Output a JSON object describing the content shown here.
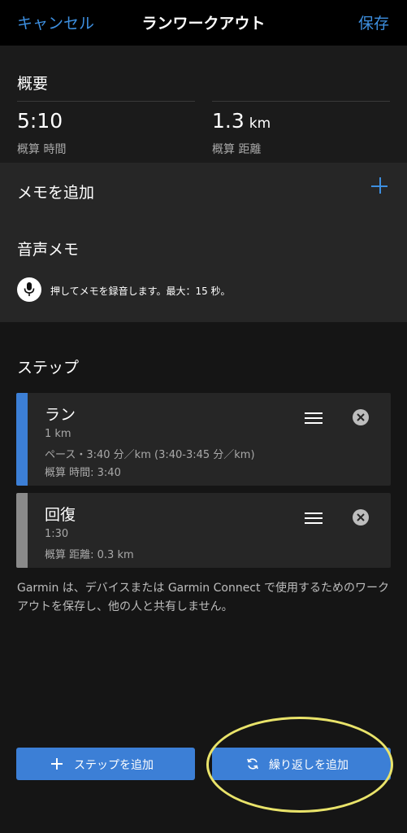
{
  "header": {
    "cancel_label": "キャンセル",
    "title": "ランワークアウト",
    "save_label": "保存"
  },
  "overview": {
    "section_title": "概要",
    "time_value": "5:10",
    "time_label": "概算 時間",
    "distance_value": "1.3",
    "distance_unit": "km",
    "distance_label": "概算 距離"
  },
  "notes": {
    "add_note_label": "メモを追加",
    "voice_memo_title": "音声メモ",
    "voice_memo_hint": "押してメモを録音します。最大：15 秒。"
  },
  "steps": {
    "section_title": "ステップ",
    "items": [
      {
        "name": "ラン",
        "line1": "1 km",
        "line2": "ペース・3:40 分／km (3:40-3:45 分／km)",
        "line3": "概算 時間: 3:40",
        "color": "#3c7fd6"
      },
      {
        "name": "回復",
        "line1": "1:30",
        "line2": "概算 距離: 0.3 km",
        "color": "#8a8a8a"
      }
    ]
  },
  "disclaimer": "Garmin は、デバイスまたは Garmin Connect で使用するためのワークアウトを保存し、他の人と共有しません。",
  "buttons": {
    "add_step_label": "ステップを追加",
    "add_repeat_label": "繰り返しを追加"
  },
  "colors": {
    "accent": "#3d8fe0",
    "button": "#3c7fd6",
    "highlight": "#e9e36a"
  }
}
